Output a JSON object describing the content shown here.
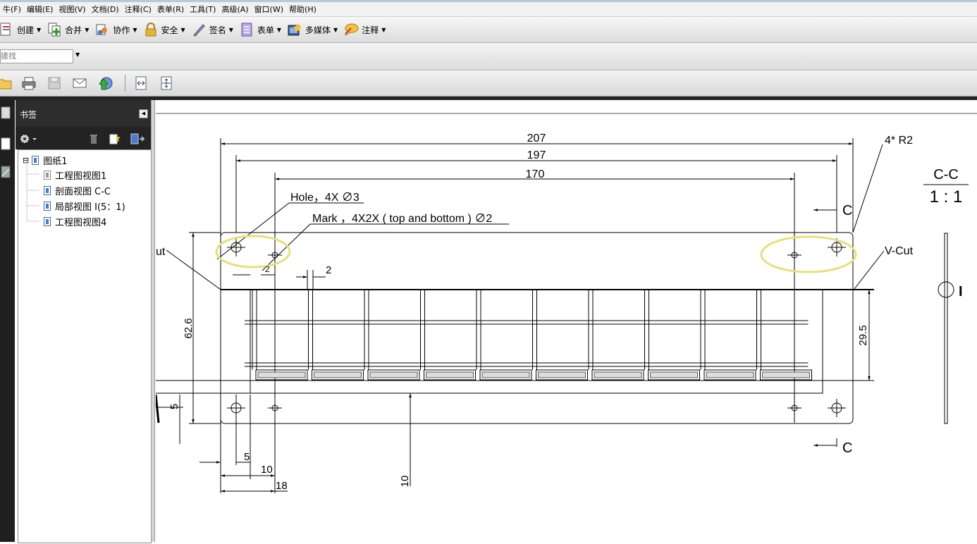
{
  "menubar": {
    "items": [
      "牛(F)",
      "编辑(E)",
      "视图(V)",
      "文档(D)",
      "注释(C)",
      "表单(R)",
      "工具(T)",
      "高级(A)",
      "窗口(W)",
      "帮助(H)"
    ]
  },
  "toolbar_tasks": {
    "create": "创建",
    "combine": "合并",
    "collaborate": "协作",
    "secure": "安全",
    "sign": "签名",
    "forms": "表单",
    "multimedia": "多媒体",
    "comment": "注释"
  },
  "search": {
    "value": "搓找"
  },
  "navigation": {
    "panel_title": "书签",
    "bookmarks": [
      {
        "label": "图纸1",
        "expander": "⊟"
      },
      {
        "label": "工程图视图1"
      },
      {
        "label": "剖面视图 C-C"
      },
      {
        "label": "局部视图 I(5：1)"
      },
      {
        "label": "工程图视图4"
      }
    ]
  },
  "drawing": {
    "dims": {
      "d207": "207",
      "d197": "197",
      "d170": "170",
      "d62_6": "62.6",
      "d29_5": "29.5",
      "d2": "2",
      "d5a": "5",
      "d5b": "5",
      "d10a": "10",
      "d10b": "10",
      "d18": "18",
      "d2b": "2"
    },
    "notes": {
      "hole": "Hole，4X ∅3",
      "mark": "Mark ，4X2X ( top and bottom ) ∅2",
      "radius": "4* R2",
      "vcut_right": "V-Cut",
      "vcut_left": "ut",
      "section_mark_top": "C",
      "section_mark_bottom": "C",
      "section_title": "C-C",
      "section_scale": "1 : 1",
      "detail_label": "I"
    },
    "highlight_color": "#e6e07a"
  }
}
